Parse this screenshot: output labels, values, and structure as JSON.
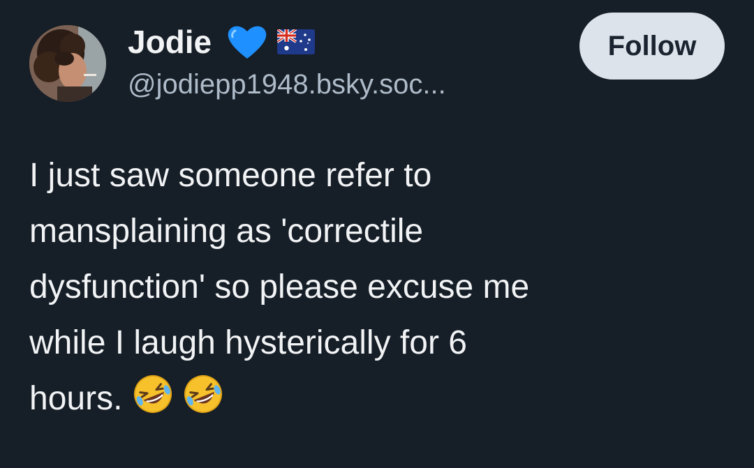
{
  "post": {
    "author": {
      "display_name": "Jodie",
      "handle": "@jodiepp1948.bsky.soc...",
      "badges": [
        "blue-heart-icon",
        "australia-flag-icon"
      ]
    },
    "follow_label": "Follow",
    "text_lines": [
      "I just saw someone refer to",
      "mansplaining as 'correctile",
      "dysfunction' so please excuse me",
      "while I laugh hysterically for 6",
      "hours."
    ],
    "trailing_emojis": [
      "rolling-on-floor-laughing-icon",
      "rolling-on-floor-laughing-icon"
    ]
  },
  "colors": {
    "background": "#161e27",
    "text": "#f1f3f5",
    "handle": "#aebbc9",
    "follow_bg": "#dde3ea",
    "follow_text": "#1a2330",
    "heart": "#1e90ff"
  }
}
